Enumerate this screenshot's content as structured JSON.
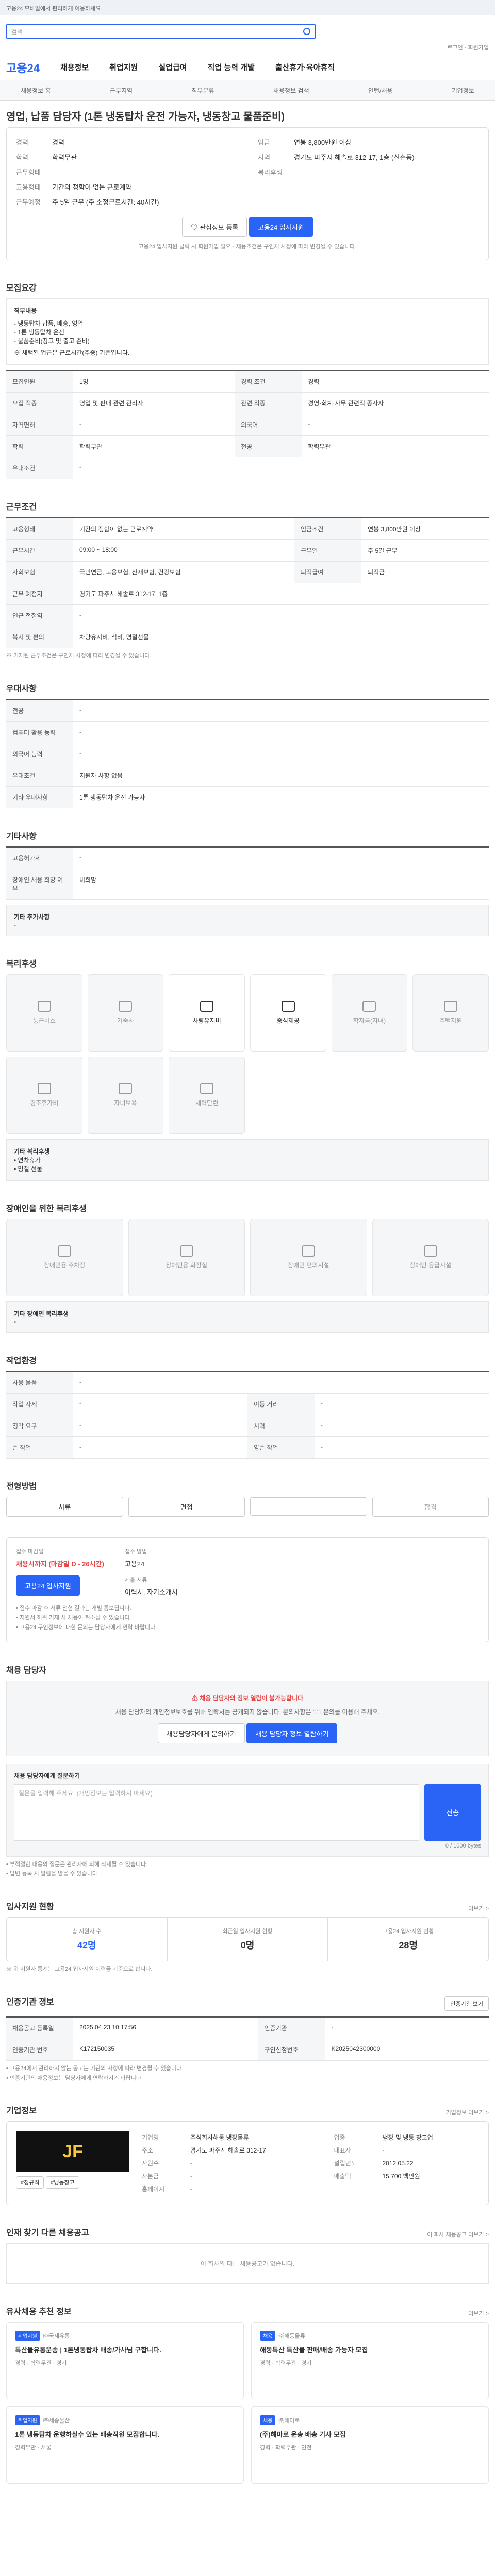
{
  "topbar": {
    "text": "고용24 모바일에서 편리하게 이용하세요"
  },
  "search": {
    "placeholder": "검색"
  },
  "util": {
    "links": "로그인 · 회원가입"
  },
  "gnb": {
    "logo": "고용24",
    "menus": [
      "채용정보",
      "취업지원",
      "실업급여",
      "직업 능력 개발",
      "출산휴가·육아휴직"
    ]
  },
  "lnb": {
    "items": [
      "채용정보 홈",
      "근무지역",
      "직무분류",
      "채용정보 검색",
      "인턴/채용",
      "기업정보"
    ]
  },
  "job": {
    "title": "영업, 납품 담당자 (1톤 냉동탑차 운전 가능자, 냉동창고 물품준비)",
    "left": [
      {
        "k": "경력",
        "v": "경력"
      },
      {
        "k": "학력",
        "v": "학력무관"
      },
      {
        "k": "근무형태",
        "v": ""
      },
      {
        "k": "고용형태",
        "v": "기간의 정함이 없는 근로계약"
      },
      {
        "k": "근무예정",
        "v": "주 5일 근무 (주 소정근로시간: 40시간)"
      }
    ],
    "right": [
      {
        "k": "임금",
        "v": "연봉 3,800만원 이상"
      },
      {
        "k": "지역",
        "v": "경기도 파주시 해솔로 312-17, 1층 (신촌동)"
      },
      {
        "k": "복리후생",
        "v": ""
      }
    ],
    "scrap": "관심정보 등록",
    "apply": "고용24 입사지원",
    "note": "고용24 입사지원 클릭 시 회원가입 필요 · 채용조건은 구인처 사정에 따라 변경될 수 있습니다."
  },
  "recruit": {
    "heading": "모집요강",
    "desc_title": "직무내용",
    "desc": [
      "- 냉동탑차 납품, 배송, 영업",
      "- 1톤 냉동탑차 운전",
      "- 물품준비(창고 및 출고 준비)",
      "※ 채택된 업급은 근로시간(주중) 기준입니다."
    ],
    "rows": [
      [
        "모집인원",
        "1명",
        "경력 조건",
        "경력"
      ],
      [
        "모집 직종",
        "영업 및 판매 관련 관리자",
        "관련 직종",
        "경영·회계·사무 관련직 종사자"
      ],
      [
        "자격면허",
        "-",
        "외국어",
        "-"
      ],
      [
        "학력",
        "학력무관",
        "전공",
        "학력무관"
      ],
      [
        "우대조건",
        "-",
        "",
        ""
      ]
    ]
  },
  "cond": {
    "heading": "근무조건",
    "rows": [
      [
        "고용형태",
        "기간의 정함이 없는 근로계약",
        "임금조건",
        "연봉 3,800만원 이상"
      ],
      [
        "근무시간",
        "09:00 ~ 18:00",
        "근무일",
        "주 5일 근무"
      ],
      [
        "사회보험",
        "국민연금, 고용보험, 산재보험, 건강보험",
        "퇴직급여",
        "퇴직금"
      ],
      [
        "근무 예정지",
        "경기도 파주시 해솔로 312-17, 1층",
        "",
        ""
      ],
      [
        "인근 전철역",
        "-",
        "",
        ""
      ],
      [
        "복지 및 편의",
        "차량유지비, 식비, 명절선물",
        "",
        ""
      ]
    ],
    "note": "※ 기재된 근무조건은 구인처 사정에 따라 변경될 수 있습니다."
  },
  "pref": {
    "heading": "우대사항",
    "rows": [
      [
        "전공",
        "-"
      ],
      [
        "컴퓨터 활용 능력",
        "-"
      ],
      [
        "외국어 능력",
        "-"
      ],
      [
        "우대조건",
        "지원자 사항 없음"
      ],
      [
        "기타 우대사항",
        "1톤 냉동탑차 운전 가능자"
      ]
    ]
  },
  "etc": {
    "heading": "기타사항",
    "rows": [
      [
        "고용허가제",
        "-"
      ],
      [
        "장애인 채용 희망 여부",
        "비희망"
      ]
    ],
    "extra_title": "기타 추가사항",
    "extra": "-"
  },
  "welfare": {
    "heading": "복리후생",
    "items": [
      {
        "l": "통근버스",
        "on": false
      },
      {
        "l": "기숙사",
        "on": false
      },
      {
        "l": "차량유지비",
        "on": true
      },
      {
        "l": "중식제공",
        "on": true
      },
      {
        "l": "학자금(자녀)",
        "on": false
      },
      {
        "l": "주택지원",
        "on": false
      },
      {
        "l": "경조휴가비",
        "on": false
      },
      {
        "l": "자녀보육",
        "on": false
      },
      {
        "l": "체력단련",
        "on": false
      }
    ],
    "other_title": "기타 복리후생",
    "other": [
      "• 연차휴가",
      "• 명절 선물"
    ]
  },
  "disab": {
    "heading": "장애인을 위한 복리후생",
    "items": [
      "장애인용 주차장",
      "장애인용 화장실",
      "장애인 편의시설",
      "장애인 응급시설"
    ],
    "other_title": "기타 장애인 복리후생",
    "other": "-"
  },
  "env": {
    "heading": "작업환경",
    "rows": [
      [
        "사용 물품",
        "-",
        "",
        ""
      ],
      [
        "작업 자세",
        "-",
        "이동 거리",
        "-"
      ],
      [
        "청각 요구",
        "-",
        "시력",
        "-"
      ],
      [
        "손 작업",
        "-",
        "양손 작업",
        "-"
      ]
    ]
  },
  "process": {
    "heading": "전형방법",
    "steps": [
      "서류",
      "면접",
      "",
      "합격"
    ]
  },
  "method": {
    "deadline_label": "접수 마감일",
    "deadline": "채용시까지 (마감일 D - 26시간)",
    "method_label": "접수 방법",
    "method": "고용24",
    "docs_label": "제출 서류",
    "docs": "이력서, 자기소개서",
    "apply": "고용24 입사지원",
    "notes": [
      "• 접수 마감 후 서류 전형 결과는 개별 통보됩니다.",
      "• 지원서 허위 기재 시 채용이 취소될 수 있습니다.",
      "• 고용24 구인정보에 대한 문의는 담당자에게 연락 바랍니다."
    ]
  },
  "contact": {
    "heading": "채용 담당자",
    "alert": "채용 담당자의 정보 열람이 불가능합니다",
    "msg": "채용 담당자의 개인정보보호를 위해 연락처는 공개되지 않습니다. 문의사항은 1:1 문의를 이용해 주세요.",
    "btn1": "채용담당자에게 문의하기",
    "btn2": "채용 담당자 정보 열람하기"
  },
  "qna": {
    "heading": "채용 담당자에게 질문하기",
    "placeholder": "질문을 입력해 주세요. (개인정보는 입력하지 마세요)",
    "count": "0 / 1000 bytes",
    "send": "전송",
    "notes": [
      "• 부적절한 내용의 질문은 관리자에 의해 삭제될 수 있습니다.",
      "• 답변 등록 시 알림을 받을 수 있습니다."
    ]
  },
  "stats": {
    "heading": "입사지원 현황",
    "more": "더보기 >",
    "items": [
      {
        "l": "총 지원자 수",
        "v": "42명"
      },
      {
        "l": "최근일 입사지원 현황",
        "v": "0명"
      },
      {
        "l": "고용24 입사지원 현황",
        "v": "28명"
      }
    ],
    "note": "※ 위 지원자 통계는 고용24 입사지원 이력을 기준으로 합니다."
  },
  "info": {
    "heading": "인증기관 정보",
    "btn": "인증기관 보기",
    "rows": [
      [
        "채용공고 등록일",
        "2025.04.23 10:17:56",
        "인증기관",
        "-"
      ],
      [
        "인증기관 번호",
        "K172150035",
        "구인신청번호",
        "K2025042300000"
      ]
    ],
    "notes": [
      "• 고용24에서 관리하지 않는 공고는 기관의 사정에 따라 변경될 수 있습니다.",
      "• 인증기관의 채용정보는 담당자에게 연락하시기 바랍니다."
    ]
  },
  "corp": {
    "heading": "기업정보",
    "more": "기업정보 더보기 >",
    "logo_text": "JF",
    "tags": [
      "#정규직",
      "#냉동창고"
    ],
    "rows": [
      [
        "기업명",
        "주식회사해동 냉장물류",
        "업종",
        "냉장 및 냉동 창고업"
      ],
      [
        "주소",
        "경기도 파주시 해솔로 312-17",
        "대표자",
        "-"
      ],
      [
        "사원수",
        "-",
        "설립년도",
        "2012.05.22"
      ],
      [
        "자본금",
        "-",
        "매출액",
        "15.700 백만원"
      ],
      [
        "홈페이지",
        "-",
        "",
        ""
      ]
    ]
  },
  "others": {
    "heading": "인재 찾기 다른 채용공고",
    "more": "이 회사 채용공고 더보기 >",
    "empty": "이 회사의 다른 채용공고가 없습니다."
  },
  "recommend": {
    "heading": "유사채용 추천 정보",
    "more": "더보기 >",
    "items": [
      {
        "tag": "취업지원",
        "co": "㈜국제유통",
        "t": "특산물유통운송 | 1톤냉동탑차 배송/가사님 구합니다.",
        "i": "경력 · 학력무관 · 경기"
      },
      {
        "tag": "채용",
        "co": "㈜해동물류",
        "t": "해동특산 특산물 판매/배송 가능자 모집",
        "i": "경력 · 학력무관 · 경기"
      },
      {
        "tag": "취업지원",
        "co": "㈜세종물산",
        "t": "1톤 냉동탑차 운행하실수 있는 배송직원 모집합니다.",
        "i": "경력무관 · 서울"
      },
      {
        "tag": "채용",
        "co": "㈜해마로",
        "t": "(주)해마로 운송 배송 기사 모집",
        "i": "경력 · 학력무관 · 인천"
      }
    ]
  }
}
